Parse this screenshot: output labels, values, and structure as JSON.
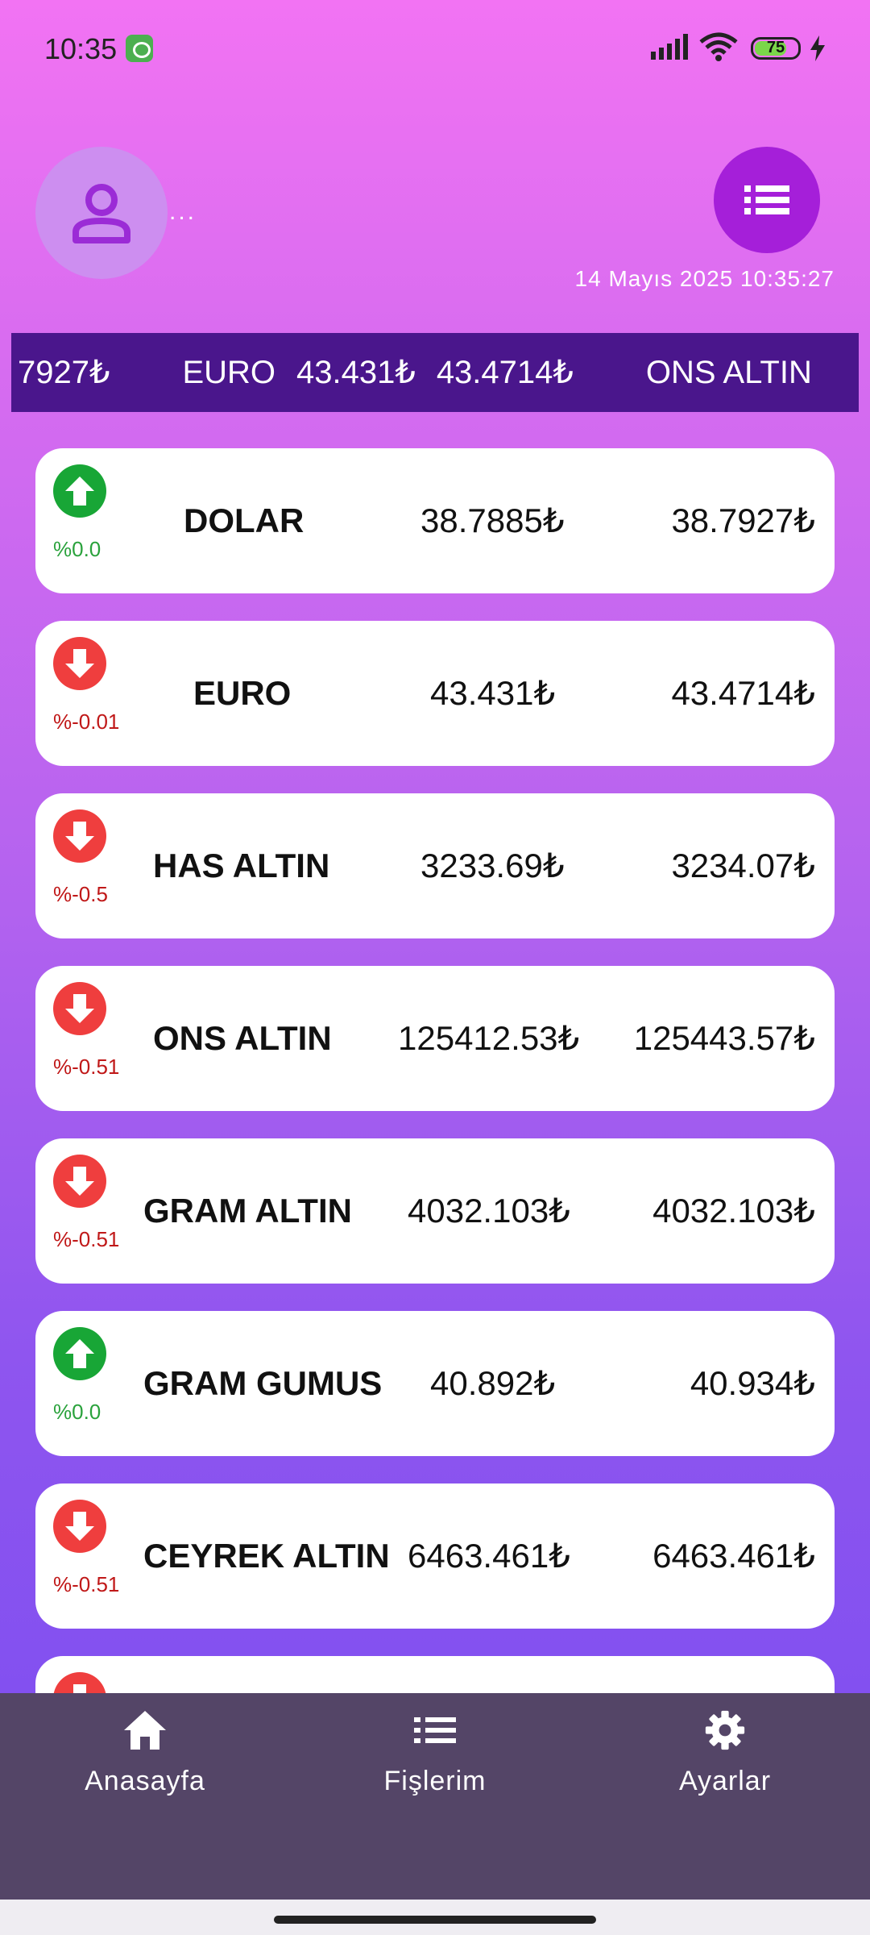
{
  "status_bar": {
    "time": "10:35",
    "battery": "75"
  },
  "header": {
    "user_dots": "...",
    "datetime": "14 Mayıs 2025 10:35:27"
  },
  "ticker": {
    "items": [
      "7927₺",
      "EURO",
      "43.431₺",
      "43.4714₺",
      "ONS ALTIN"
    ]
  },
  "rates": [
    {
      "name": "DOLAR",
      "change": "%0.0",
      "trend": "up",
      "buy": "38.7885₺",
      "sell": "38.7927₺"
    },
    {
      "name": "EURO",
      "change": "%-0.01",
      "trend": "down",
      "buy": "43.431₺",
      "sell": "43.4714₺"
    },
    {
      "name": "HAS ALTIN",
      "change": "%-0.5",
      "trend": "down",
      "buy": "3233.69₺",
      "sell": "3234.07₺"
    },
    {
      "name": "ONS ALTIN",
      "change": "%-0.51",
      "trend": "down",
      "buy": "125412.53₺",
      "sell": "125443.57₺"
    },
    {
      "name": "GRAM ALTIN",
      "change": "%-0.51",
      "trend": "down",
      "buy": "4032.103₺",
      "sell": "4032.103₺"
    },
    {
      "name": "GRAM GUMUS",
      "change": "%0.0",
      "trend": "up",
      "buy": "40.892₺",
      "sell": "40.934₺"
    },
    {
      "name": "CEYREK ALTIN",
      "change": "%-0.51",
      "trend": "down",
      "buy": "6463.461₺",
      "sell": "6463.461₺"
    },
    {
      "name": "",
      "change": "",
      "trend": "down",
      "buy": "",
      "sell": ""
    }
  ],
  "bottom_nav": {
    "home": "Anasayfa",
    "receipts": "Fişlerim",
    "settings": "Ayarlar"
  },
  "colors": {
    "up": "#18a636",
    "down": "#ef3e3e",
    "ticker_bg": "#4a168c",
    "nav_bg": "#544567",
    "menu_button": "#a51fd9"
  }
}
